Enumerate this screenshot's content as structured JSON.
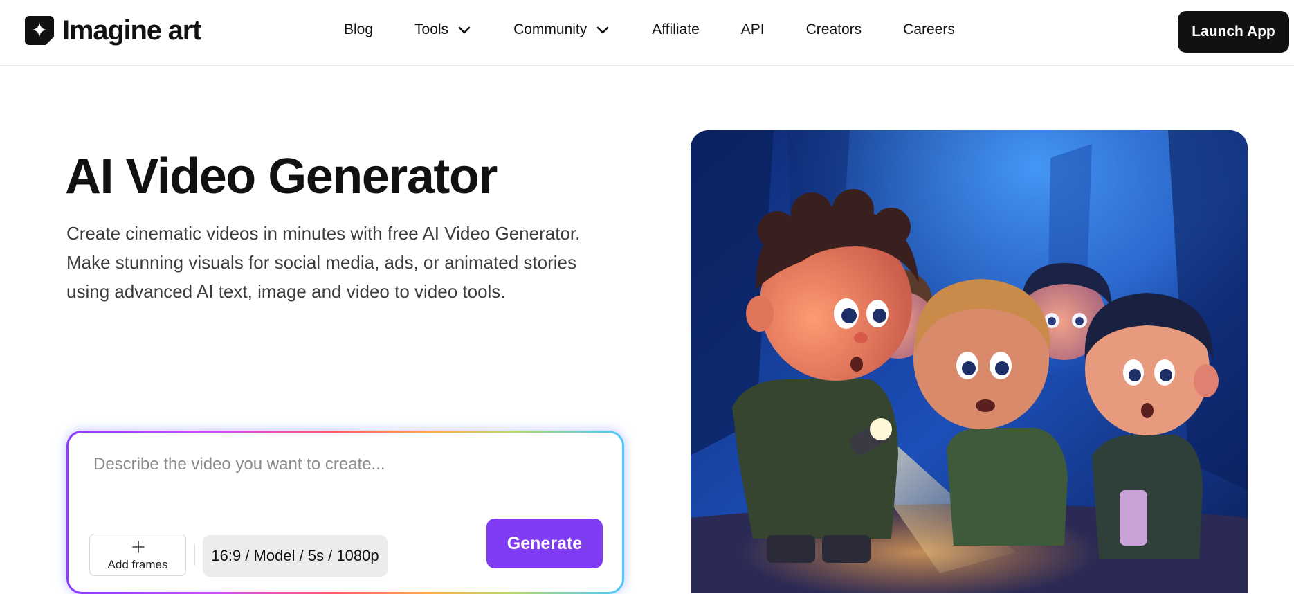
{
  "header": {
    "brand": "Imagine art",
    "nav": [
      {
        "label": "Blog",
        "has_dropdown": false
      },
      {
        "label": "Tools",
        "has_dropdown": true
      },
      {
        "label": "Community",
        "has_dropdown": true
      },
      {
        "label": "Affiliate",
        "has_dropdown": false
      },
      {
        "label": "API",
        "has_dropdown": false
      },
      {
        "label": "Creators",
        "has_dropdown": false
      },
      {
        "label": "Careers",
        "has_dropdown": false
      }
    ],
    "launch_label": "Launch App"
  },
  "hero": {
    "title": "AI Video Generator",
    "description": "Create cinematic videos in minutes with free AI Video Generator. Make stunning visuals for social media, ads, or animated stories using advanced AI text, image and video to video tools."
  },
  "prompt": {
    "placeholder": "Describe the video you want to create...",
    "value": "",
    "add_frames_label": "Add frames",
    "settings_label": "16:9 / Model / 5s / 1080p",
    "generate_label": "Generate"
  },
  "colors": {
    "brand_dark": "#111111",
    "accent_purple": "#7f3cf2",
    "chip_gray": "#ececec"
  },
  "icons": {
    "logo": "sparkle-logo-icon",
    "dropdown": "chevron-down-icon",
    "add": "plus-icon"
  }
}
